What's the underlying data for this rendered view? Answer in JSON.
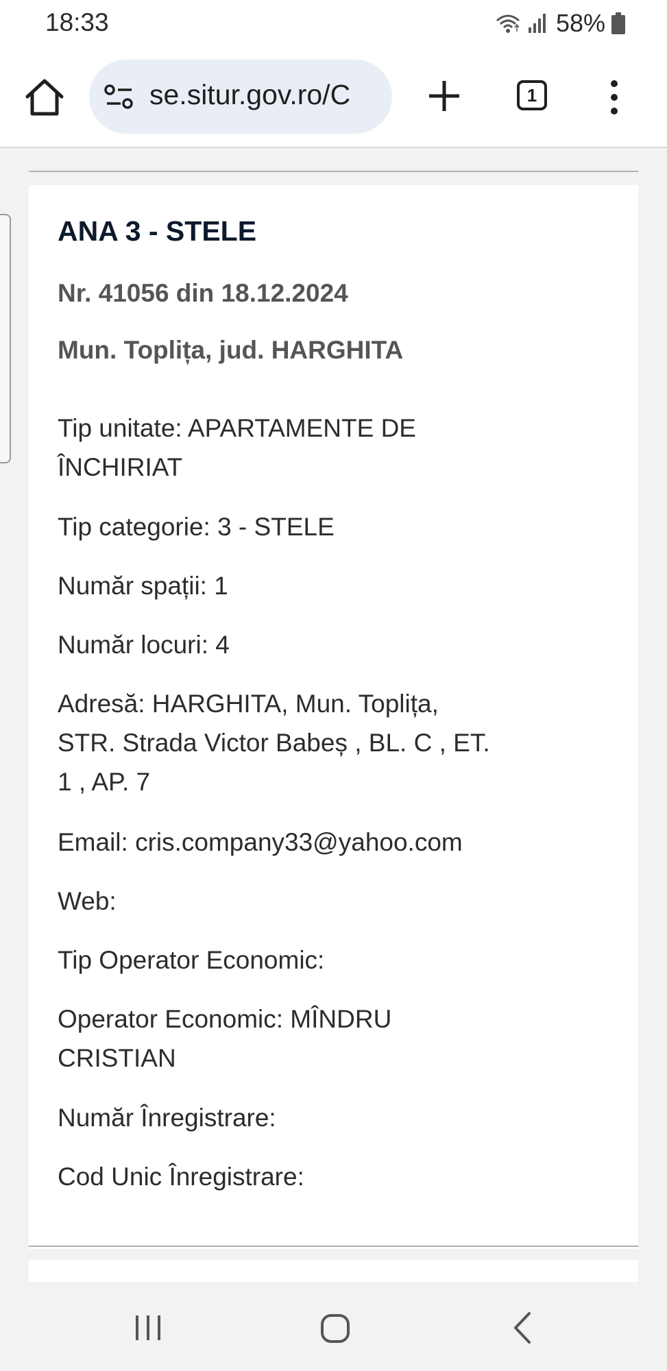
{
  "status_bar": {
    "time": "18:33",
    "battery": "58%",
    "icons": [
      "wifi-icon",
      "signal-icon",
      "battery-icon"
    ]
  },
  "browser": {
    "url": "se.situr.gov.ro/C",
    "tab_count": "1",
    "icons": [
      "home-icon",
      "site-settings-icon",
      "plus-icon",
      "tabs-icon",
      "more-vert-icon"
    ]
  },
  "listing": {
    "title": "ANA 3 - STELE",
    "registration": "Nr. 41056 din 18.12.2024",
    "location": "Mun. Toplița, jud. HARGHITA",
    "unit_type": {
      "line1": "Tip unitate: APARTAMENTE DE",
      "line2": "ÎNCHIRIAT"
    },
    "category": "Tip categorie: 3 - STELE",
    "spaces": "Număr spații: 1",
    "places": "Număr locuri: 4",
    "address": {
      "line1": "Adresă: HARGHITA, Mun. Toplița,",
      "line2": "STR. Strada Victor Babeș , BL. C , ET.",
      "line3": "1 , AP. 7"
    },
    "email": "Email: cris.company33@yahoo.com",
    "web": "Web:",
    "operator_type": "Tip Operator Economic:",
    "operator": {
      "line1": "Operator Economic: MÎNDRU",
      "line2": "CRISTIAN"
    },
    "reg_number": "Număr Înregistrare:",
    "unique_code": "Cod Unic Înregistrare:"
  },
  "nav_bar": {
    "icons": [
      "recent-apps-icon",
      "home-circle-icon",
      "back-icon"
    ]
  }
}
